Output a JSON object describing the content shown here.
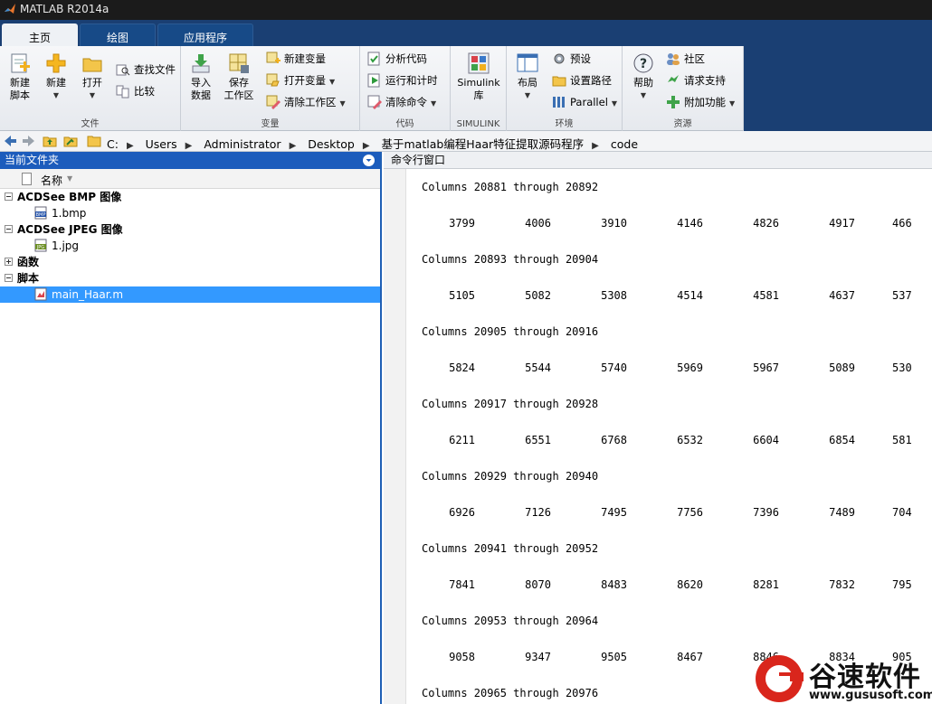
{
  "window": {
    "title": "MATLAB R2014a"
  },
  "tabs": [
    {
      "label": "主页",
      "active": true
    },
    {
      "label": "绘图",
      "active": false
    },
    {
      "label": "应用程序",
      "active": false
    }
  ],
  "ribbon": {
    "file": {
      "label": "文件",
      "new_script": "新建\n脚本",
      "new": "新建",
      "open": "打开",
      "find_files": "查找文件",
      "compare": "比较"
    },
    "variable": {
      "label": "变量",
      "import_data": "导入\n数据",
      "save_workspace": "保存\n工作区",
      "new_variable": "新建变量",
      "open_variable": "打开变量",
      "clear_workspace": "清除工作区"
    },
    "code": {
      "label": "代码",
      "analyze": "分析代码",
      "run_time": "运行和计时",
      "clear_commands": "清除命令"
    },
    "simulink": {
      "label": "SIMULINK",
      "library": "Simulink\n库"
    },
    "environment": {
      "label": "环境",
      "layout": "布局",
      "preferences": "预设",
      "set_path": "设置路径",
      "parallel": "Parallel"
    },
    "resources": {
      "label": "资源",
      "help": "帮助",
      "community": "社区",
      "support": "请求支持",
      "addons": "附加功能"
    }
  },
  "address": {
    "crumbs": [
      "C:",
      "Users",
      "Administrator",
      "Desktop",
      "基于matlab编程Haar特征提取源码程序",
      "code"
    ]
  },
  "left_panel": {
    "title": "当前文件夹",
    "column_name": "名称",
    "groups": [
      {
        "label": "ACDSee BMP 图像",
        "expanded": true,
        "files": [
          {
            "name": "1.bmp",
            "icon": "bmp-file-icon"
          }
        ]
      },
      {
        "label": "ACDSee JPEG 图像",
        "expanded": true,
        "files": [
          {
            "name": "1.jpg",
            "icon": "jpeg-file-icon"
          }
        ]
      },
      {
        "label": "函数",
        "expanded": false,
        "files": []
      },
      {
        "label": "脚本",
        "expanded": true,
        "files": [
          {
            "name": "main_Haar.m",
            "icon": "m-file-icon",
            "selected": true
          }
        ]
      }
    ]
  },
  "command_window": {
    "title": "命令行窗口",
    "blocks": [
      {
        "header": "Columns 20881 through 20892",
        "values": [
          "3799",
          "4006",
          "3910",
          "4146",
          "4826",
          "4917",
          "466"
        ]
      },
      {
        "header": "Columns 20893 through 20904",
        "values": [
          "5105",
          "5082",
          "5308",
          "4514",
          "4581",
          "4637",
          "537"
        ]
      },
      {
        "header": "Columns 20905 through 20916",
        "values": [
          "5824",
          "5544",
          "5740",
          "5969",
          "5967",
          "5089",
          "530"
        ]
      },
      {
        "header": "Columns 20917 through 20928",
        "values": [
          "6211",
          "6551",
          "6768",
          "6532",
          "6604",
          "6854",
          "581"
        ]
      },
      {
        "header": "Columns 20929 through 20940",
        "values": [
          "6926",
          "7126",
          "7495",
          "7756",
          "7396",
          "7489",
          "704"
        ]
      },
      {
        "header": "Columns 20941 through 20952",
        "values": [
          "7841",
          "8070",
          "8483",
          "8620",
          "8281",
          "7832",
          "795"
        ]
      },
      {
        "header": "Columns 20953 through 20964",
        "values": [
          "9058",
          "9347",
          "9505",
          "8467",
          "8846",
          "8834",
          "905"
        ]
      },
      {
        "header": "Columns 20965 through 20976",
        "values": []
      }
    ]
  },
  "watermark": {
    "brand": "谷速软件",
    "url": "www.gususoft.com"
  },
  "colors": {
    "tab_bg": "#1a3f73",
    "panel_header": "#1c5cbc",
    "selection": "#3399ff",
    "brand_red": "#d9261c"
  }
}
